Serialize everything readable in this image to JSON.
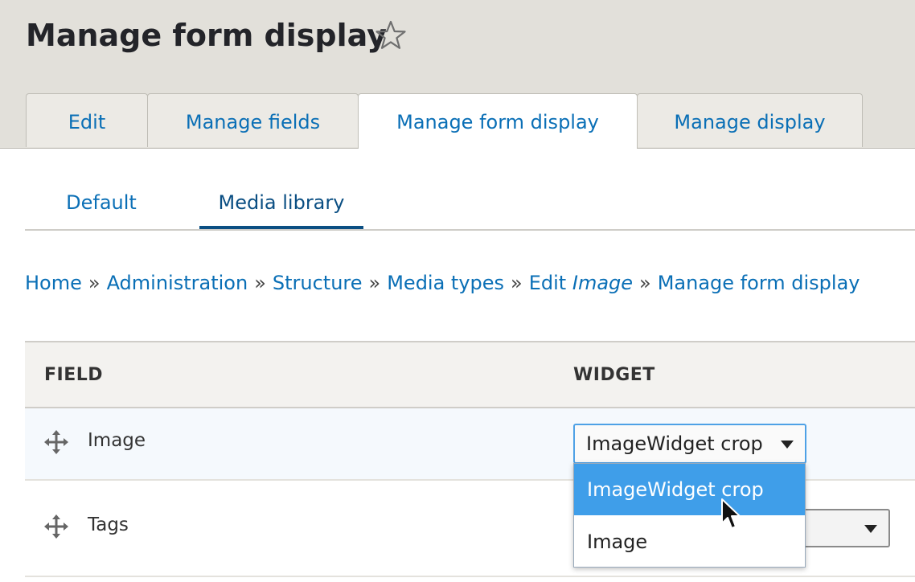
{
  "page": {
    "title": "Manage form display"
  },
  "primary_tabs": [
    {
      "label": "Edit",
      "active": false
    },
    {
      "label": "Manage fields",
      "active": false
    },
    {
      "label": "Manage form display",
      "active": true
    },
    {
      "label": "Manage display",
      "active": false
    }
  ],
  "secondary_tabs": [
    {
      "label": "Default",
      "active": false
    },
    {
      "label": "Media library",
      "active": true
    }
  ],
  "breadcrumb": {
    "items": [
      "Home",
      "Administration",
      "Structure",
      "Media types"
    ],
    "edit_prefix": "Edit",
    "edit_entity": "Image",
    "last": "Manage form display",
    "separator": "»"
  },
  "table": {
    "headers": {
      "field": "FIELD",
      "widget": "WIDGET"
    },
    "rows": [
      {
        "field": "Image",
        "widget": "ImageWidget crop"
      },
      {
        "field": "Tags",
        "widget": ""
      }
    ]
  },
  "dropdown": {
    "options": [
      "ImageWidget crop",
      "Image"
    ],
    "highlighted": "ImageWidget crop"
  },
  "colors": {
    "link": "#0a6fb6",
    "active_tab_underline": "#0b4f83",
    "header_bg": "#e2e0da",
    "option_highlight": "#3f9ee9"
  },
  "icons": {
    "favorite": "star-outline-icon",
    "drag": "move-arrows-icon",
    "select_caret": "caret-down-icon",
    "pointer": "mouse-pointer-icon"
  }
}
